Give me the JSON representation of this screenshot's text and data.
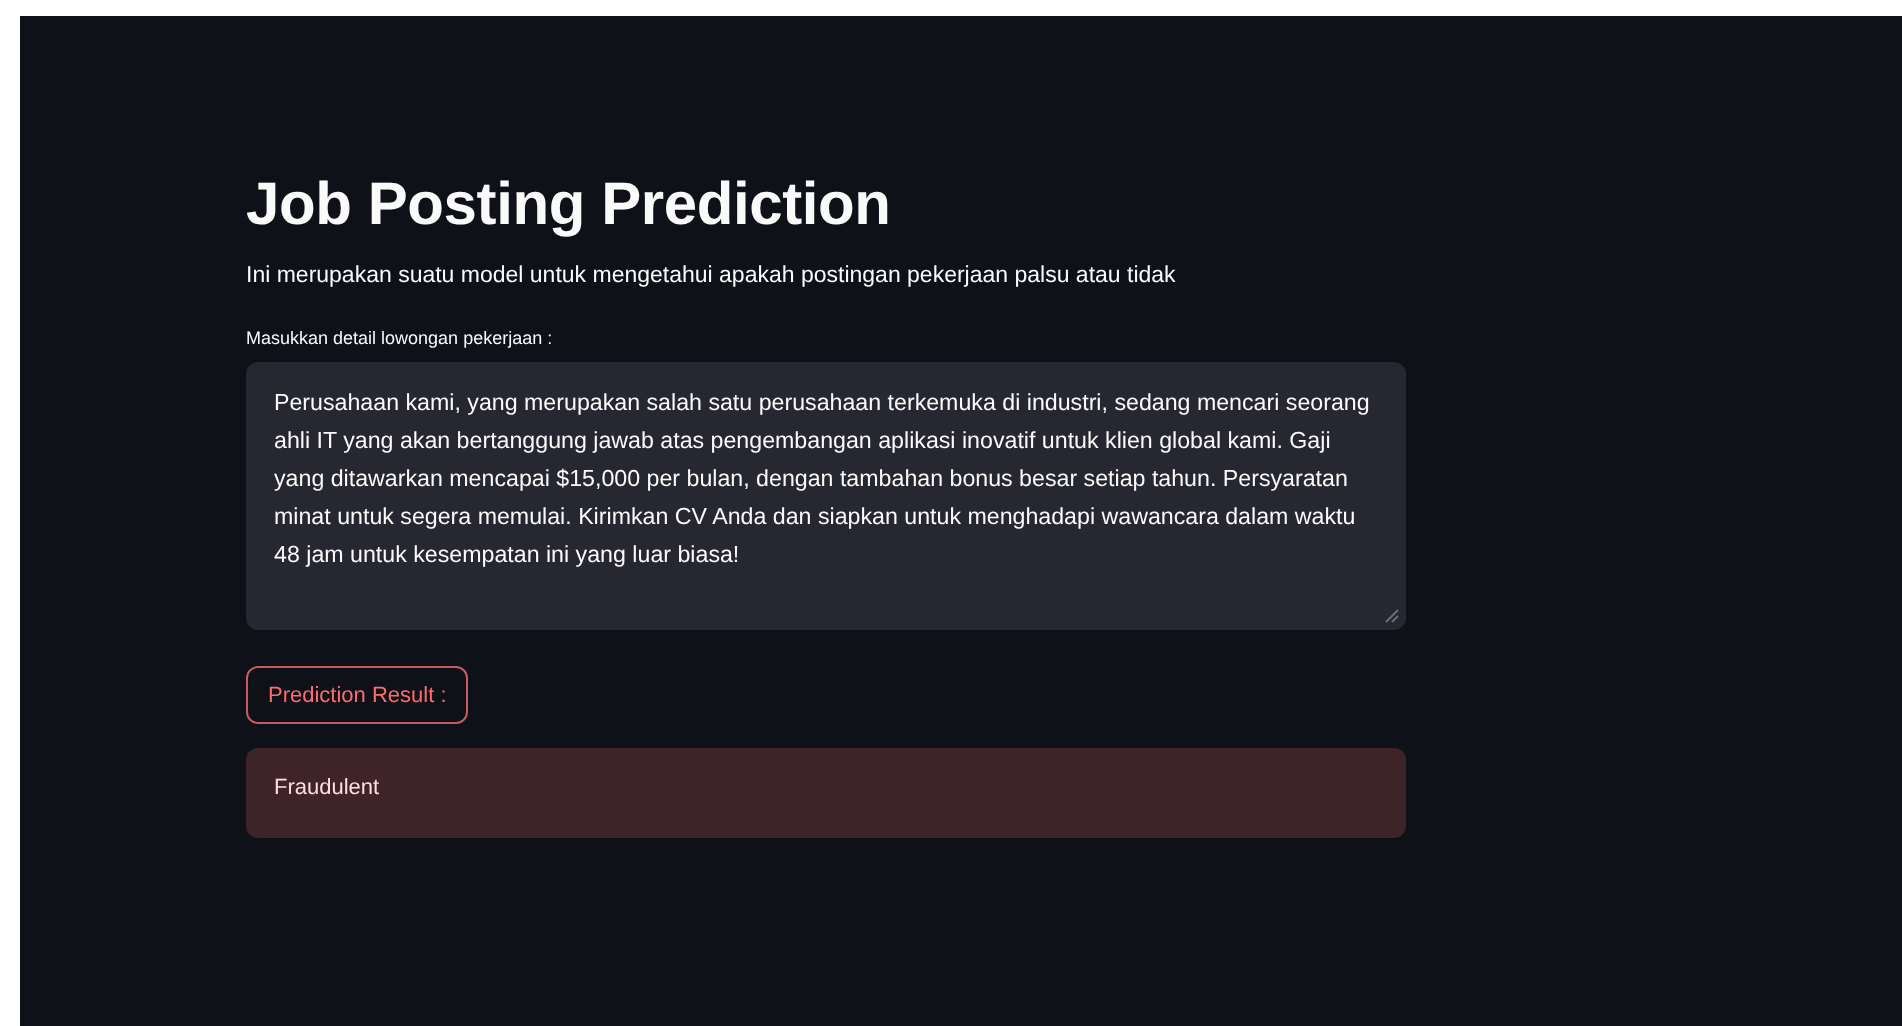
{
  "title": "Job Posting Prediction",
  "description": "Ini merupakan suatu model untuk mengetahui apakah postingan pekerjaan palsu atau tidak",
  "input": {
    "label": "Masukkan detail lowongan pekerjaan :",
    "value": "Perusahaan kami, yang merupakan salah satu perusahaan terkemuka di industri, sedang mencari seorang ahli IT yang akan bertanggung jawab atas pengembangan aplikasi inovatif untuk klien global kami. Gaji yang ditawarkan mencapai $15,000 per bulan, dengan tambahan bonus besar setiap tahun. Persyaratan minat untuk segera memulai. Kirimkan CV Anda dan siapkan untuk menghadapi wawancara dalam waktu 48 jam untuk kesempatan ini yang luar biasa!"
  },
  "button": {
    "label": "Prediction Result :"
  },
  "result": {
    "text": "Fraudulent",
    "kind": "error"
  }
}
